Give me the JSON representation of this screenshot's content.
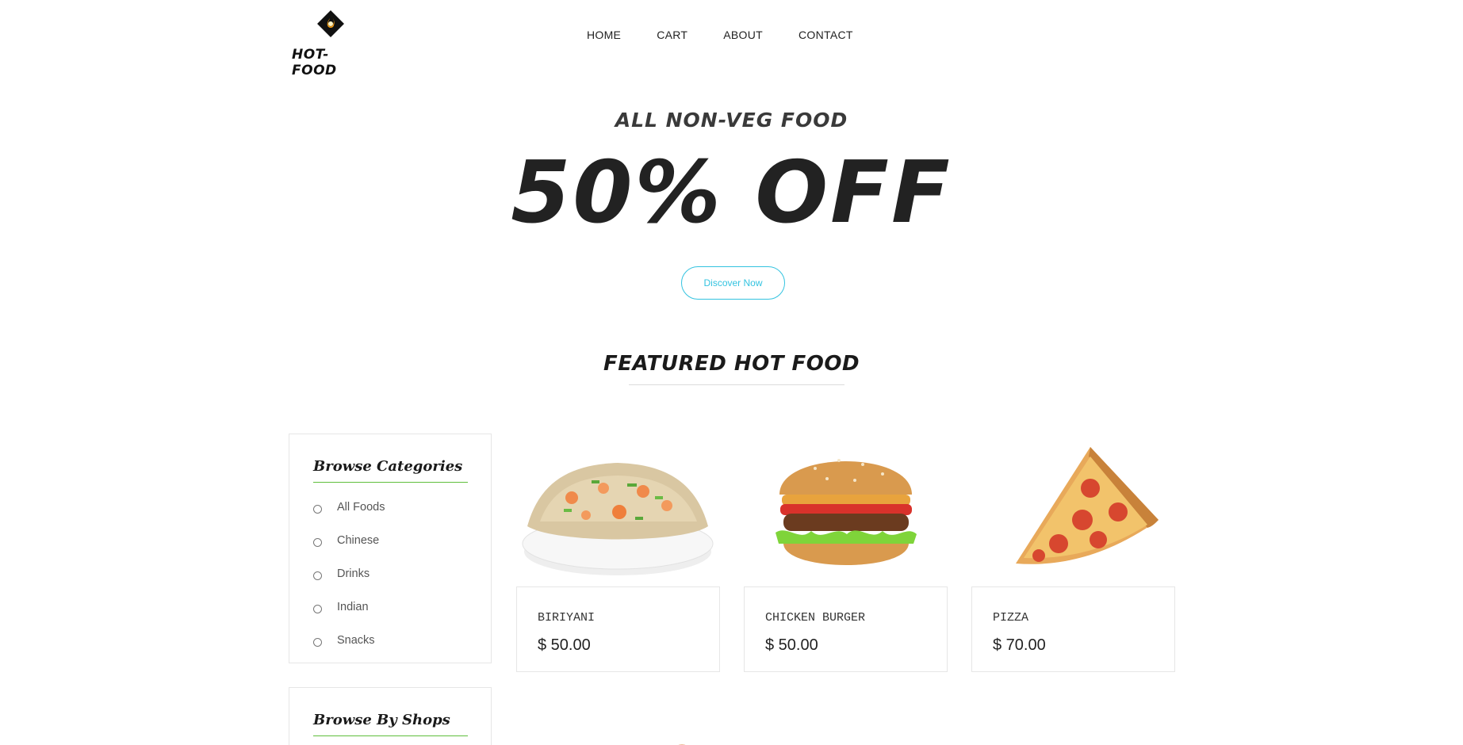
{
  "brand": {
    "name": "HOT-FOOD"
  },
  "nav": {
    "items": [
      "HOME",
      "CART",
      "ABOUT",
      "CONTACT"
    ]
  },
  "hero": {
    "subtitle": "ALL NON-VEG FOOD",
    "title": "50% OFF",
    "cta_label": "Discover Now"
  },
  "featured": {
    "heading": "FEATURED HOT FOOD"
  },
  "sidebar": {
    "categories_title": "Browse Categories",
    "categories": [
      "All Foods",
      "Chinese",
      "Drinks",
      "Indian",
      "Snacks"
    ],
    "shops_title": "Browse By Shops"
  },
  "products": [
    {
      "name": "BIRIYANI",
      "price": "$ 50.00",
      "image": "biriyani-image"
    },
    {
      "name": "CHICKEN BURGER",
      "price": "$ 50.00",
      "image": "burger-image"
    },
    {
      "name": "PIZZA",
      "price": "$ 70.00",
      "image": "pizza-slice-image"
    }
  ],
  "colors": {
    "accent": "#33c3e0",
    "widget_rule": "#5fbf3c",
    "logo_flame": "#f39c12",
    "text_dark": "#222222"
  }
}
